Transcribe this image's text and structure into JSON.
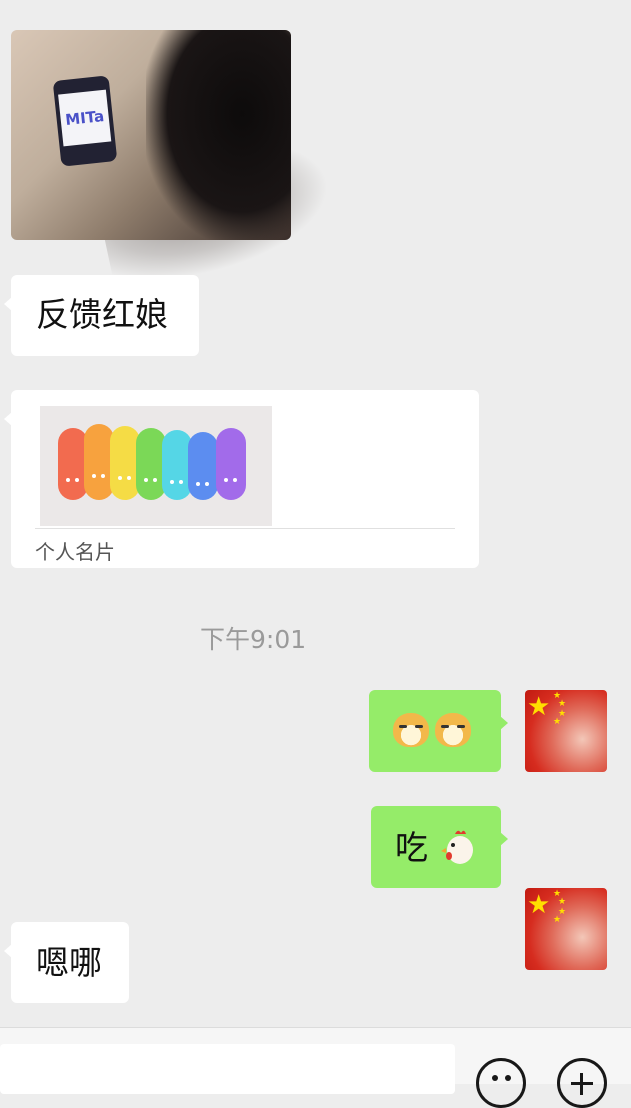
{
  "messages": {
    "image_message": {
      "logo_text": "MITa"
    },
    "text_feedback": "反馈红娘",
    "card": {
      "label": "个人名片"
    },
    "timestamp": "下午9:01",
    "out_text": "吃",
    "reply_text": "嗯哪"
  },
  "icons": {
    "emoji_in_message_1": "dog-face-emoji",
    "emoji_in_message_2": "chicken-emoji",
    "avatar": "china-flag-avatar",
    "toolbar_left": "smiley-icon",
    "toolbar_right": "plus-icon"
  },
  "colors": {
    "chat_background": "#ededed",
    "incoming_bubble": "#ffffff",
    "outgoing_bubble": "#95ec69",
    "timestamp_text": "#9a9a9a"
  }
}
